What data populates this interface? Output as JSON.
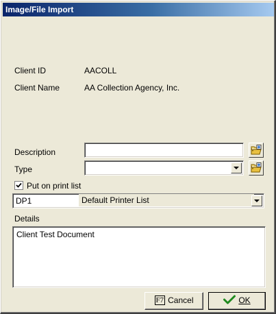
{
  "window": {
    "title": "Image/File Import"
  },
  "client": {
    "id_label": "Client ID",
    "id_value": "AACOLL",
    "name_label": "Client Name",
    "name_value": "AA Collection Agency, Inc."
  },
  "description": {
    "label": "Description",
    "value": "",
    "button_icon": "folder-add-icon"
  },
  "type": {
    "label": "Type",
    "value": "",
    "button_icon": "folder-add-icon"
  },
  "print_list": {
    "checkbox_label": "Put on print list",
    "checked": true,
    "code": "DP1",
    "name": "Default Printer List"
  },
  "details": {
    "label": "Details",
    "value": "Client Test Document"
  },
  "buttons": {
    "cancel_key": "F7",
    "cancel_label": "Cancel",
    "ok_label": "OK"
  },
  "colors": {
    "title_start": "#0a246a",
    "title_end": "#a6caf0",
    "face": "#ece9d8",
    "ok_check": "#1f8a1f"
  }
}
